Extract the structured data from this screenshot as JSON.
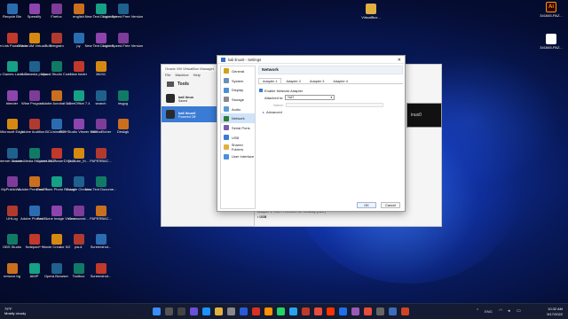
{
  "desktop": {
    "col1": [
      "Recycle Bin",
      "CyberLink PowerDirec...",
      "Epic Games Launcher",
      "blender",
      "Microsoft Edge",
      "Internet Downlo...",
      "MyPublicWi...",
      "UHLog",
      "OBS Studio",
      "remove.bg"
    ],
    "col2": [
      "Speedify",
      "Oracle VM VirtualBox",
      "VLC media player",
      "Wise Program...",
      "Adobe Audition...",
      "Adobe Media Encoder 2022",
      "Adobe Premiere P...",
      "Adobe Photosh...",
      "Notepad++",
      "AIMP"
    ],
    "col3": [
      "Firefox",
      "Telegram",
      "Visual Studio Code",
      "Adobe Acrobat DC",
      "BCUninstaller",
      "CyberLink PowerDVD 21",
      "FastStone Photo Resizer",
      "FastStone Image Viewer",
      "Movie Creator 5/2",
      "Opera Browser"
    ],
    "col4": [
      "english",
      "py",
      "New folder",
      "LibreOffice 7.4",
      "PDF Studio Viewer 2022",
      "youtube_th...",
      "Google Chrome",
      "Crossword...",
      "psu1",
      "Toolbox"
    ],
    "col5": [
      "New Text Document",
      "New Text Docume...",
      "28201",
      "search",
      "balenaEtcher",
      "PAPERBAC...",
      "New Text Docume...",
      "PAPERBAC...",
      "Screenshot...",
      "Screenshot..."
    ],
    "col6": [
      "Light Speed Free Version",
      "Light Speed Free Version",
      "",
      "imgpg",
      "Deskgk",
      "",
      "",
      "",
      "",
      ""
    ],
    "right_top": "VirtualBox...",
    "right_icon1": "341845-PAZ...",
    "right_icon2": "341845-PAZ..."
  },
  "manager": {
    "title": "Oracle VM VirtualBox Manager",
    "menu": [
      "File",
      "Machine",
      "Help"
    ],
    "tools_label": "Tools",
    "vms": [
      {
        "name": "kali linux",
        "state": "Saved"
      },
      {
        "name": "kali linux0",
        "state": "Powered Off"
      }
    ],
    "adapter_line": "Adapter 1:   Intel PRO/1000 MT Desktop (NAT)",
    "usb_label": "USB",
    "preview_text": "inux0"
  },
  "dialog": {
    "title": "kali linux0 - Settings",
    "close": "✕",
    "nav": [
      "General",
      "System",
      "Display",
      "Storage",
      "Audio",
      "Network",
      "Serial Ports",
      "USB",
      "Shared Folders",
      "User Interface"
    ],
    "header": "Network",
    "tabs": [
      "Adapter 1",
      "Adapter 2",
      "Adapter 3",
      "Adapter 4"
    ],
    "enable_label": "Enable Network Adapter",
    "attached_label": "Attached to:",
    "attached_value": "NAT",
    "name_label": "Name:",
    "advanced_label": "Advanced",
    "ok": "OK",
    "cancel": "Cancel"
  },
  "taskbar": {
    "weather_temp": "79°F",
    "weather_desc": "Mostly cloudy",
    "lang": "ENG",
    "time": "10:32 AM",
    "date": "9/17/2022"
  }
}
